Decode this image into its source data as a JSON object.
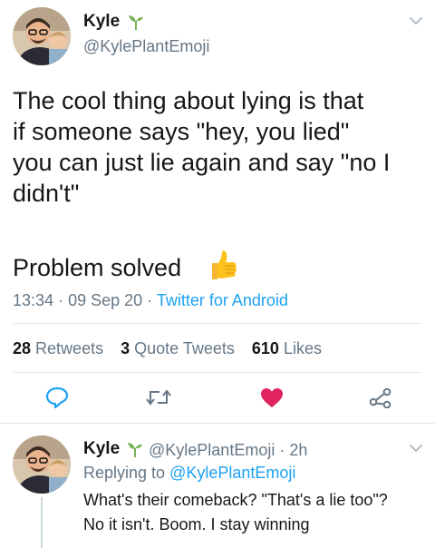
{
  "tweet": {
    "author_name": "Kyle",
    "author_handle": "@KylePlantEmoji",
    "body_lines": [
      "The cool thing about lying is that",
      "if someone says \"hey, you lied\"",
      "you can just lie again and say \"no I",
      "didn't\""
    ],
    "body_second": "Problem solved",
    "time": "13:34",
    "sep": "·",
    "date": "09 Sep 20",
    "source": "Twitter for Android",
    "retweets_count": "28",
    "retweets_label": "Retweets",
    "quotes_count": "3",
    "quotes_label": "Quote Tweets",
    "likes_count": "610",
    "likes_label": "Likes",
    "liked": true
  },
  "reply": {
    "author_name": "Kyle",
    "author_handle": "@KylePlantEmoji",
    "age": "2h",
    "replying_prefix": "Replying to",
    "replying_to": "@KylePlantEmoji",
    "text_lines": [
      "What's their comeback? \"That's a lie too\"?",
      "No it isn't. Boom. I stay winning"
    ]
  },
  "colors": {
    "accent": "#1da1f2",
    "like": "#e0245e",
    "muted": "#657786",
    "sprout": "#77b255"
  }
}
